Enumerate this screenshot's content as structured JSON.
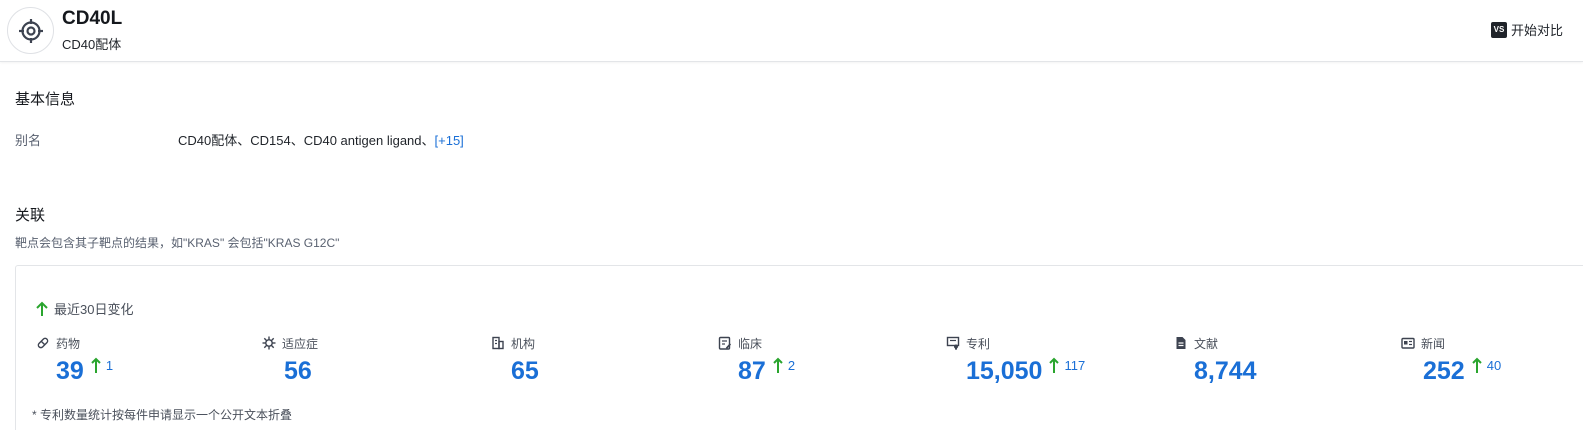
{
  "header": {
    "title": "CD40L",
    "subtitle": "CD40配体",
    "compare_badge": "VS",
    "compare_label": "开始对比"
  },
  "basic_info": {
    "section_title": "基本信息",
    "alias_label": "别名",
    "alias_value": "CD40配体、CD154、CD40 antigen ligand、",
    "alias_more": "[+15]"
  },
  "related": {
    "section_title": "关联",
    "note": "靶点会包含其子靶点的结果，如\"KRAS\" 会包括\"KRAS G12C\"",
    "recent_label": "最近30日变化",
    "stats": [
      {
        "label": "药物",
        "icon": "pill-icon",
        "value": "39",
        "delta": "1"
      },
      {
        "label": "适应症",
        "icon": "virus-icon",
        "value": "56",
        "delta": ""
      },
      {
        "label": "机构",
        "icon": "building-icon",
        "value": "65",
        "delta": ""
      },
      {
        "label": "临床",
        "icon": "clinical-icon",
        "value": "87",
        "delta": "2"
      },
      {
        "label": "专利",
        "icon": "patent-icon",
        "value": "15,050",
        "delta": "117"
      },
      {
        "label": "文献",
        "icon": "document-icon",
        "value": "8,744",
        "delta": ""
      },
      {
        "label": "新闻",
        "icon": "news-icon",
        "value": "252",
        "delta": "40"
      }
    ],
    "footnote": "* 专利数量统计按每件申请显示一个公开文本折叠"
  },
  "colors": {
    "accent": "#1a6fd6",
    "up_arrow": "#2aa52e"
  }
}
